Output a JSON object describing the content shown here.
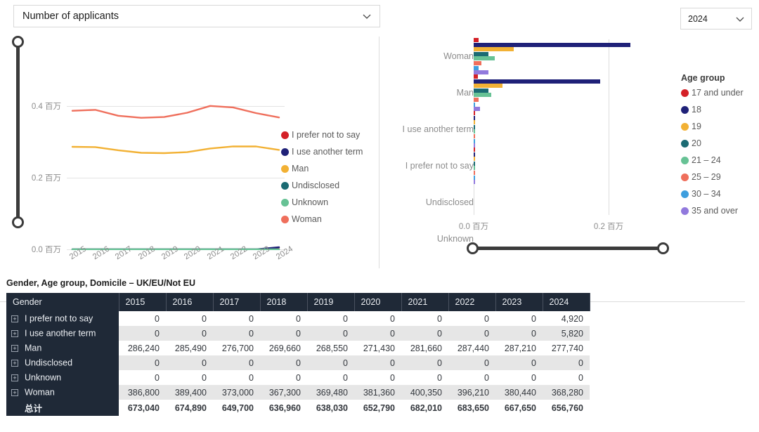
{
  "header": {
    "measure_label": "Number of applicants",
    "measure_icon": "chevron-down-icon",
    "year_value": "2024",
    "year_icon": "chevron-down-icon"
  },
  "line_chart": {
    "y_ticks": [
      "0.4 百万",
      "0.2 百万",
      "0.0 百万"
    ],
    "legend_title": "",
    "legend": [
      {
        "label": "I prefer not to say",
        "color": "#d42027"
      },
      {
        "label": "I use another term",
        "color": "#1f2178"
      },
      {
        "label": "Man",
        "color": "#f2b134"
      },
      {
        "label": "Undisclosed",
        "color": "#1b6b73"
      },
      {
        "label": "Unknown",
        "color": "#67c295"
      },
      {
        "label": "Woman",
        "color": "#ef6f5c"
      }
    ]
  },
  "bar_chart": {
    "x_ticks": [
      "0.0 百万",
      "0.2 百万"
    ],
    "categories": [
      "Woman",
      "Man",
      "I use another term",
      "I prefer not to say",
      "Undisclosed",
      "Unknown"
    ],
    "legend_title": "Age group",
    "legend": [
      {
        "label": "17 and under",
        "color": "#d42027"
      },
      {
        "label": "18",
        "color": "#1f2178"
      },
      {
        "label": "19",
        "color": "#f2b134"
      },
      {
        "label": "20",
        "color": "#1b6b73"
      },
      {
        "label": "21 – 24",
        "color": "#67c295"
      },
      {
        "label": "25 – 29",
        "color": "#ef6f5c"
      },
      {
        "label": "30 – 34",
        "color": "#3d9ede"
      },
      {
        "label": "35 and over",
        "color": "#9179dd"
      }
    ]
  },
  "table": {
    "title": "Gender, Age group, Domicile – UK/EU/Not EU",
    "first_column_header": "Gender",
    "year_headers": [
      "2015",
      "2016",
      "2017",
      "2018",
      "2019",
      "2020",
      "2021",
      "2022",
      "2023",
      "2024"
    ],
    "expander_icon": "plus-box-icon",
    "rows": [
      {
        "label": "I prefer not to say",
        "expandable": true,
        "values": [
          "0",
          "0",
          "0",
          "0",
          "0",
          "0",
          "0",
          "0",
          "0",
          "4,920"
        ]
      },
      {
        "label": "I use another term",
        "expandable": true,
        "values": [
          "0",
          "0",
          "0",
          "0",
          "0",
          "0",
          "0",
          "0",
          "0",
          "5,820"
        ]
      },
      {
        "label": "Man",
        "expandable": true,
        "values": [
          "286,240",
          "285,490",
          "276,700",
          "269,660",
          "268,550",
          "271,430",
          "281,660",
          "287,440",
          "287,210",
          "277,740"
        ]
      },
      {
        "label": "Undisclosed",
        "expandable": true,
        "values": [
          "0",
          "0",
          "0",
          "0",
          "0",
          "0",
          "0",
          "0",
          "0",
          "0"
        ]
      },
      {
        "label": "Unknown",
        "expandable": true,
        "values": [
          "0",
          "0",
          "0",
          "0",
          "0",
          "0",
          "0",
          "0",
          "0",
          "0"
        ]
      },
      {
        "label": "Woman",
        "expandable": true,
        "values": [
          "386,800",
          "389,400",
          "373,000",
          "367,300",
          "369,480",
          "381,360",
          "400,350",
          "396,210",
          "380,440",
          "368,280"
        ]
      },
      {
        "label": "总计",
        "expandable": false,
        "values": [
          "673,040",
          "674,890",
          "649,700",
          "636,960",
          "638,030",
          "652,790",
          "682,010",
          "683,650",
          "667,650",
          "656,760"
        ]
      }
    ]
  },
  "chart_data": [
    {
      "type": "line",
      "title": "Number of applicants",
      "xlabel": "",
      "ylabel": "百万",
      "x": [
        "2015",
        "2016",
        "2017",
        "2018",
        "2019",
        "2020",
        "2021",
        "2022",
        "2023",
        "2024"
      ],
      "ylim": [
        0,
        0.45
      ],
      "yticks": [
        0.0,
        0.2,
        0.4
      ],
      "ytick_labels": [
        "0.0 百万",
        "0.2 百万",
        "0.4 百万"
      ],
      "grid": true,
      "legend_position": "right",
      "series": [
        {
          "name": "I prefer not to say",
          "color": "#d42027",
          "values": [
            0,
            0,
            0,
            0,
            0,
            0,
            0,
            0,
            0,
            0.00492
          ]
        },
        {
          "name": "I use another term",
          "color": "#1f2178",
          "values": [
            0,
            0,
            0,
            0,
            0,
            0,
            0,
            0,
            0,
            0.00582
          ]
        },
        {
          "name": "Man",
          "color": "#f2b134",
          "values": [
            0.28624,
            0.28549,
            0.2767,
            0.26966,
            0.26855,
            0.27143,
            0.28166,
            0.28744,
            0.28721,
            0.27774
          ]
        },
        {
          "name": "Undisclosed",
          "color": "#1b6b73",
          "values": [
            0,
            0,
            0,
            0,
            0,
            0,
            0,
            0,
            0,
            0
          ]
        },
        {
          "name": "Unknown",
          "color": "#67c295",
          "values": [
            0,
            0,
            0,
            0,
            0,
            0,
            0,
            0,
            0,
            0
          ]
        },
        {
          "name": "Woman",
          "color": "#ef6f5c",
          "values": [
            0.3868,
            0.3894,
            0.373,
            0.3673,
            0.36948,
            0.38136,
            0.40035,
            0.39621,
            0.38044,
            0.36828
          ]
        }
      ]
    },
    {
      "type": "bar",
      "orientation": "horizontal",
      "title": "",
      "xlabel": "百万",
      "ylabel": "",
      "categories": [
        "Woman",
        "Man",
        "I use another term",
        "I prefer not to say",
        "Undisclosed",
        "Unknown"
      ],
      "xlim": [
        0,
        0.26
      ],
      "xticks": [
        0.0,
        0.2
      ],
      "xtick_labels": [
        "0.0 百万",
        "0.2 百万"
      ],
      "legend_position": "right",
      "legend_title": "Age group",
      "series": [
        {
          "name": "17 and under",
          "color": "#d42027",
          "values": [
            0.0075,
            0.0065,
            0.0001,
            0.0001,
            0,
            0
          ]
        },
        {
          "name": "18",
          "color": "#1f2178",
          "values": [
            0.232,
            0.188,
            0.0006,
            0.0006,
            0,
            0
          ]
        },
        {
          "name": "19",
          "color": "#f2b134",
          "values": [
            0.0595,
            0.0425,
            0.0002,
            0.0002,
            0,
            0
          ]
        },
        {
          "name": "20",
          "color": "#1b6b73",
          "values": [
            0.0215,
            0.0215,
            0.0001,
            0.0001,
            0,
            0
          ]
        },
        {
          "name": "21 – 24",
          "color": "#67c295",
          "values": [
            0.0315,
            0.0265,
            0.0002,
            0.0002,
            0,
            0
          ]
        },
        {
          "name": "25 – 29",
          "color": "#ef6f5c",
          "values": [
            0.0115,
            0.0075,
            0.0001,
            0.0001,
            0,
            0
          ]
        },
        {
          "name": "30 – 34",
          "color": "#3d9ede",
          "values": [
            0.0075,
            0.0025,
            0.0001,
            0.0001,
            0,
            0
          ]
        },
        {
          "name": "35 and over",
          "color": "#9179dd",
          "values": [
            0.0215,
            0.0095,
            0.0001,
            0.0001,
            0,
            0
          ]
        }
      ]
    }
  ]
}
